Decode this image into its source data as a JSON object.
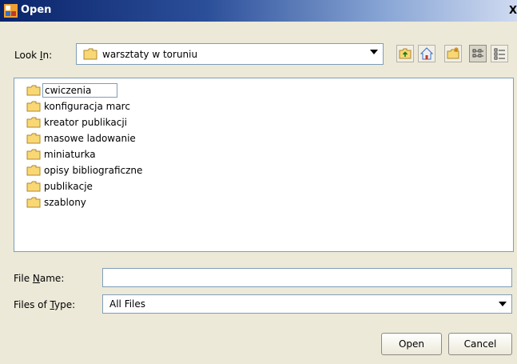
{
  "window": {
    "title": "Open",
    "close_glyph": "X"
  },
  "look_in": {
    "label_pre": "Look ",
    "label_mnemonic": "I",
    "label_post": "n:",
    "value": "warsztaty w toruniu"
  },
  "toolbar": {
    "buttons": [
      "up-one-level-icon",
      "home-icon",
      "new-folder-icon",
      "list-view-icon",
      "details-view-icon"
    ],
    "active": "list-view-icon"
  },
  "files": [
    {
      "name": "cwiczenia",
      "icon": "folder-icon",
      "selected": true
    },
    {
      "name": "konfiguracja marc",
      "icon": "folder-icon"
    },
    {
      "name": "kreator publikacji",
      "icon": "folder-icon"
    },
    {
      "name": "masowe ladowanie",
      "icon": "folder-icon"
    },
    {
      "name": "miniaturka",
      "icon": "folder-icon"
    },
    {
      "name": "opisy bibliograficzne",
      "icon": "folder-icon"
    },
    {
      "name": "publikacje",
      "icon": "folder-icon"
    },
    {
      "name": "szablony",
      "icon": "folder-icon"
    }
  ],
  "file_name": {
    "label_pre": "File ",
    "label_mnemonic": "N",
    "label_post": "ame:",
    "value": ""
  },
  "file_type": {
    "label_pre": "Files of ",
    "label_mnemonic": "T",
    "label_post": "ype:",
    "value": "All Files"
  },
  "buttons": {
    "open": "Open",
    "cancel": "Cancel"
  },
  "colors": {
    "folder_fill": "#f8d775",
    "folder_stroke": "#b08a2a",
    "title_bar": "#0a246a"
  }
}
